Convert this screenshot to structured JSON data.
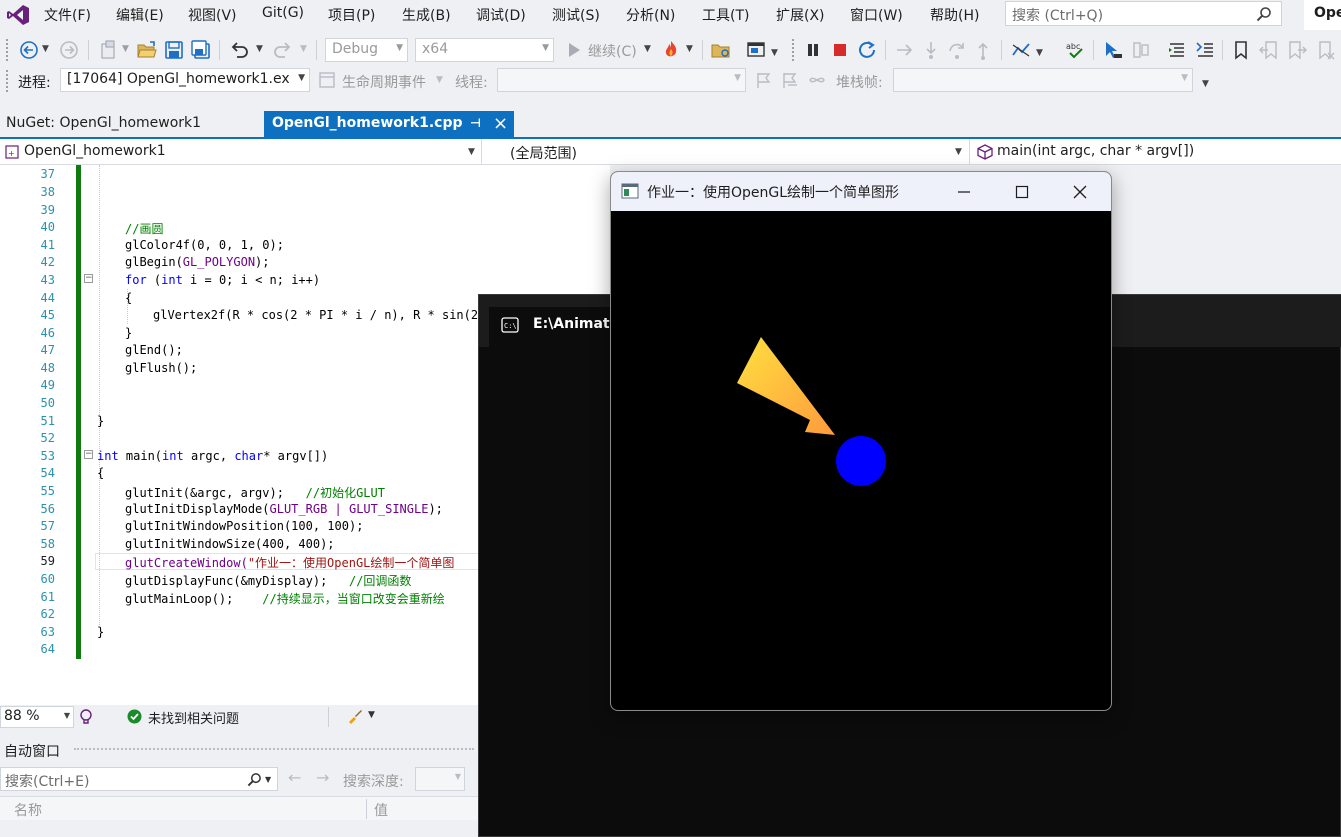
{
  "menubar": {
    "items": [
      "文件(F)",
      "编辑(E)",
      "视图(V)",
      "Git(G)",
      "项目(P)",
      "生成(B)",
      "调试(D)",
      "测试(S)",
      "分析(N)",
      "工具(T)",
      "扩展(X)",
      "窗口(W)",
      "帮助(H)"
    ],
    "search_placeholder": "搜索 (Ctrl+Q)",
    "solution_name": "Ope"
  },
  "toolbar1": {
    "config": "Debug",
    "platform": "x64",
    "continue_label": "继续(C)"
  },
  "toolbar2": {
    "process_label": "进程:",
    "process_value": "[17064] OpenGl_homework1.ex",
    "lifecycle_label": "生命周期事件",
    "thread_label": "线程:",
    "stackframe_label": "堆栈帧:"
  },
  "tabs": [
    {
      "label": "NuGet: OpenGl_homework1",
      "active": false
    },
    {
      "label": "OpenGl_homework1.cpp",
      "active": true
    }
  ],
  "navbar": {
    "project": "OpenGl_homework1",
    "scope": "(全局范围)",
    "member": "main(int argc, char * argv[])"
  },
  "editor": {
    "line_numbers": [
      "37",
      "38",
      "39",
      "40",
      "41",
      "42",
      "43",
      "44",
      "45",
      "46",
      "47",
      "48",
      "49",
      "50",
      "51",
      "52",
      "53",
      "54",
      "55",
      "56",
      "57",
      "58",
      "59",
      "60",
      "61",
      "62",
      "63",
      "64"
    ],
    "current_line": "59"
  },
  "code": {
    "l40": "//画圆",
    "l41": "glColor4f(0, 0, 1, 0);",
    "l42a": "glBegin(",
    "l42b": "GL_POLYGON",
    "l42c": ");",
    "l43a": "for",
    "l43b": " (",
    "l43c": "int",
    "l43d": " i = 0; i < n; i++)",
    "l44": "{",
    "l45": "glVertex2f(R * cos(2 * PI * i / n), R * sin(2",
    "l46": "}",
    "l47": "glEnd();",
    "l48": "glFlush();",
    "l51": "}",
    "l53a": "int",
    "l53b": " main(",
    "l53c": "int",
    "l53d": " argc, ",
    "l53e": "char",
    "l53f": "* argv[])",
    "l54": "{",
    "l55a": "glutInit(&argc, argv);   ",
    "l55b": "//初始化GLUT",
    "l56a": "glutInitDisplayMode(",
    "l56b": "GLUT_RGB | GLUT_SINGLE",
    "l56c": ");",
    "l57": "glutInitWindowPosition(100, 100);",
    "l58": "glutInitWindowSize(400, 400);",
    "l59a": "glutCreateWindow(",
    "l59b": "\"作业一：使用OpenGL绘制一个简单图",
    "l60a": "glutDisplayFunc(&myDisplay);   ",
    "l60b": "//回调函数",
    "l61a": "glutMainLoop();    ",
    "l61b": "//持续显示，当窗口改变会重新绘",
    "l63": "}"
  },
  "statusbar": {
    "zoom": "88 %",
    "issues": "未找到相关问题"
  },
  "autos": {
    "title": "自动窗口",
    "search_placeholder": "搜索(Ctrl+E)",
    "depth_label": "搜索深度:",
    "col_name": "名称",
    "col_value": "值"
  },
  "console": {
    "title": "E:\\Animatio"
  },
  "gl_window": {
    "title": "作业一：使用OpenGL绘制一个简单图形",
    "circle_color": "#0000ff",
    "triangle_colors": [
      "#ffe040",
      "#ff9a3c"
    ]
  },
  "colors": {
    "accent": "#0e70c0",
    "vs_purple": "#68217a",
    "gutter_green": "#107c10"
  }
}
